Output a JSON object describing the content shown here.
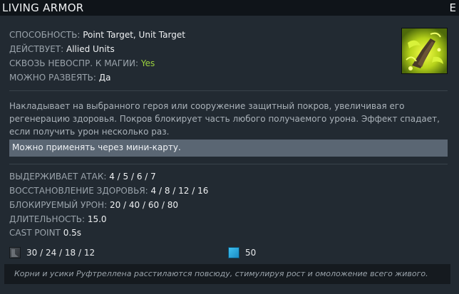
{
  "header": {
    "title": "LIVING ARMOR",
    "hotkey": "E"
  },
  "properties": [
    {
      "label": "СПОСОБНОСТЬ:",
      "value": "Point Target, Unit Target",
      "color": "#eef0f2"
    },
    {
      "label": "ДЕЙСТВУЕТ:",
      "value": "Allied Units",
      "color": "#eef0f2"
    },
    {
      "label": "СКВОЗЬ НЕВОСПР. К МАГИИ:",
      "value": "Yes",
      "color": "#9bd13e"
    },
    {
      "label": "МОЖНО РАЗВЕЯТЬ:",
      "value": "Да",
      "color": "#eef0f2"
    }
  ],
  "ability_icon": "living-armor-icon",
  "description": "Накладывает на выбранного героя или сооружение защитный покров, увеличивая его регенерацию здоровья. Покров блокирует часть любого получаемого урона. Эффект спадает, если получить урон несколько раз.",
  "note": "Можно применять через мини-карту.",
  "stats": [
    {
      "label": "ВЫДЕРЖИВАЕТ АТАК:",
      "value": "4 / 5 / 6 / 7"
    },
    {
      "label": "ВОССТАНОВЛЕНИЕ ЗДОРОВЬЯ:",
      "value": "4 / 8 / 12 / 16"
    },
    {
      "label": "БЛОКИРУЕМЫЙ УРОН:",
      "value": "20 / 40 / 60 / 80"
    },
    {
      "label": "ДЛИТЕЛЬНОСТЬ:",
      "value": "15.0"
    },
    {
      "label": "CAST POINT",
      "value": "0.5s"
    }
  ],
  "costs": {
    "cooldown": {
      "icon": "cooldown-icon",
      "value": "30 / 24 / 18 / 12"
    },
    "mana": {
      "icon": "mana-icon",
      "value": "50"
    }
  },
  "lore": "Корни и усики Руфтреллена расстилаются повсюду, стимулируя рост и омоложение всего живого."
}
